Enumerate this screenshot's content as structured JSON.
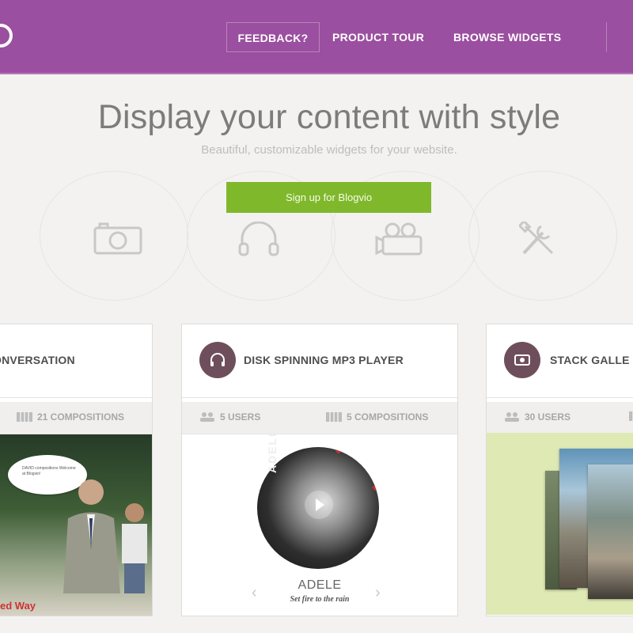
{
  "nav": {
    "feedback": "FEEDBACK?",
    "product_tour": "PRODUCT TOUR",
    "browse_widgets": "BROWSE WIDGETS"
  },
  "hero": {
    "title": "Display your content with style",
    "subtitle": "Beautiful, customizable widgets for your website.",
    "signup_label": "Sign up for Blogvio"
  },
  "features": [
    {
      "icon": "camera-icon"
    },
    {
      "icon": "headphones-icon"
    },
    {
      "icon": "video-camera-icon"
    },
    {
      "icon": "tools-icon"
    }
  ],
  "cards": [
    {
      "title": "ONVERSATION",
      "stats": [
        {
          "icon": "compositions-icon",
          "label": "21 COMPOSITIONS"
        }
      ],
      "speech": "DAVID compositions Welcome at Blogvio!",
      "banner": "ed Way"
    },
    {
      "title": "DISK SPINNING MP3 PLAYER",
      "badge_icon": "headphones-icon",
      "stats": [
        {
          "icon": "users-icon",
          "label": "5 USERS"
        },
        {
          "icon": "compositions-icon",
          "label": "5 COMPOSITIONS"
        }
      ],
      "album_text": "ADELE",
      "artist": "ADELE",
      "song": "Set fire to the rain"
    },
    {
      "title": "STACK GALLE",
      "badge_icon": "eye-icon",
      "stats": [
        {
          "icon": "users-icon",
          "label": "30 USERS"
        }
      ]
    }
  ],
  "colors": {
    "header": "#9b4fa0",
    "signup": "#80b82c",
    "badge": "#6f4e5b",
    "gallery_bg": "#dfe9b4"
  }
}
